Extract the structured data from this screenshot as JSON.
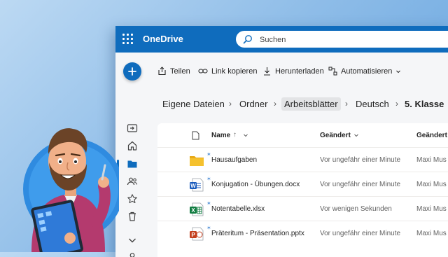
{
  "app": {
    "name": "OneDrive",
    "accent": "#0f6cbd"
  },
  "search": {
    "placeholder": "Suchen",
    "value": ""
  },
  "toolbar": {
    "share": "Teilen",
    "copy_link": "Link kopieren",
    "download": "Herunterladen",
    "automate": "Automatisieren"
  },
  "breadcrumb": [
    "Eigene Dateien",
    "Ordner",
    "Arbeitsblätter",
    "Deutsch",
    "5. Klasse"
  ],
  "table": {
    "headers": {
      "name": "Name",
      "modified": "Geändert",
      "modified_by": "Geändert"
    },
    "rows": [
      {
        "name": "Hausaufgaben",
        "icon": "folder-icon",
        "modified": "Vor ungefähr einer Minute",
        "by": "Maxi Mus"
      },
      {
        "name": "Konjugation - Übungen.docx",
        "icon": "word-icon",
        "modified": "Vor ungefähr einer Minute",
        "by": "Maxi Mus"
      },
      {
        "name": "Notentabelle.xlsx",
        "icon": "excel-icon",
        "modified": "Vor wenigen Sekunden",
        "by": "Maxi Mus"
      },
      {
        "name": "Präteritum - Präsentation.pptx",
        "icon": "powerpoint-icon",
        "modified": "Vor ungefähr einer Minute",
        "by": "Maxi Mus"
      }
    ]
  },
  "rail_icons": [
    "switch-icon",
    "home-icon",
    "folder-icon",
    "people-icon",
    "star-icon",
    "trash-icon",
    "chevron-down-icon",
    "person-icon",
    "library-icon"
  ],
  "colors": {
    "word": "#185abd",
    "excel": "#107c41",
    "powerpoint": "#c43e1c",
    "folder": "#f5c12e"
  }
}
